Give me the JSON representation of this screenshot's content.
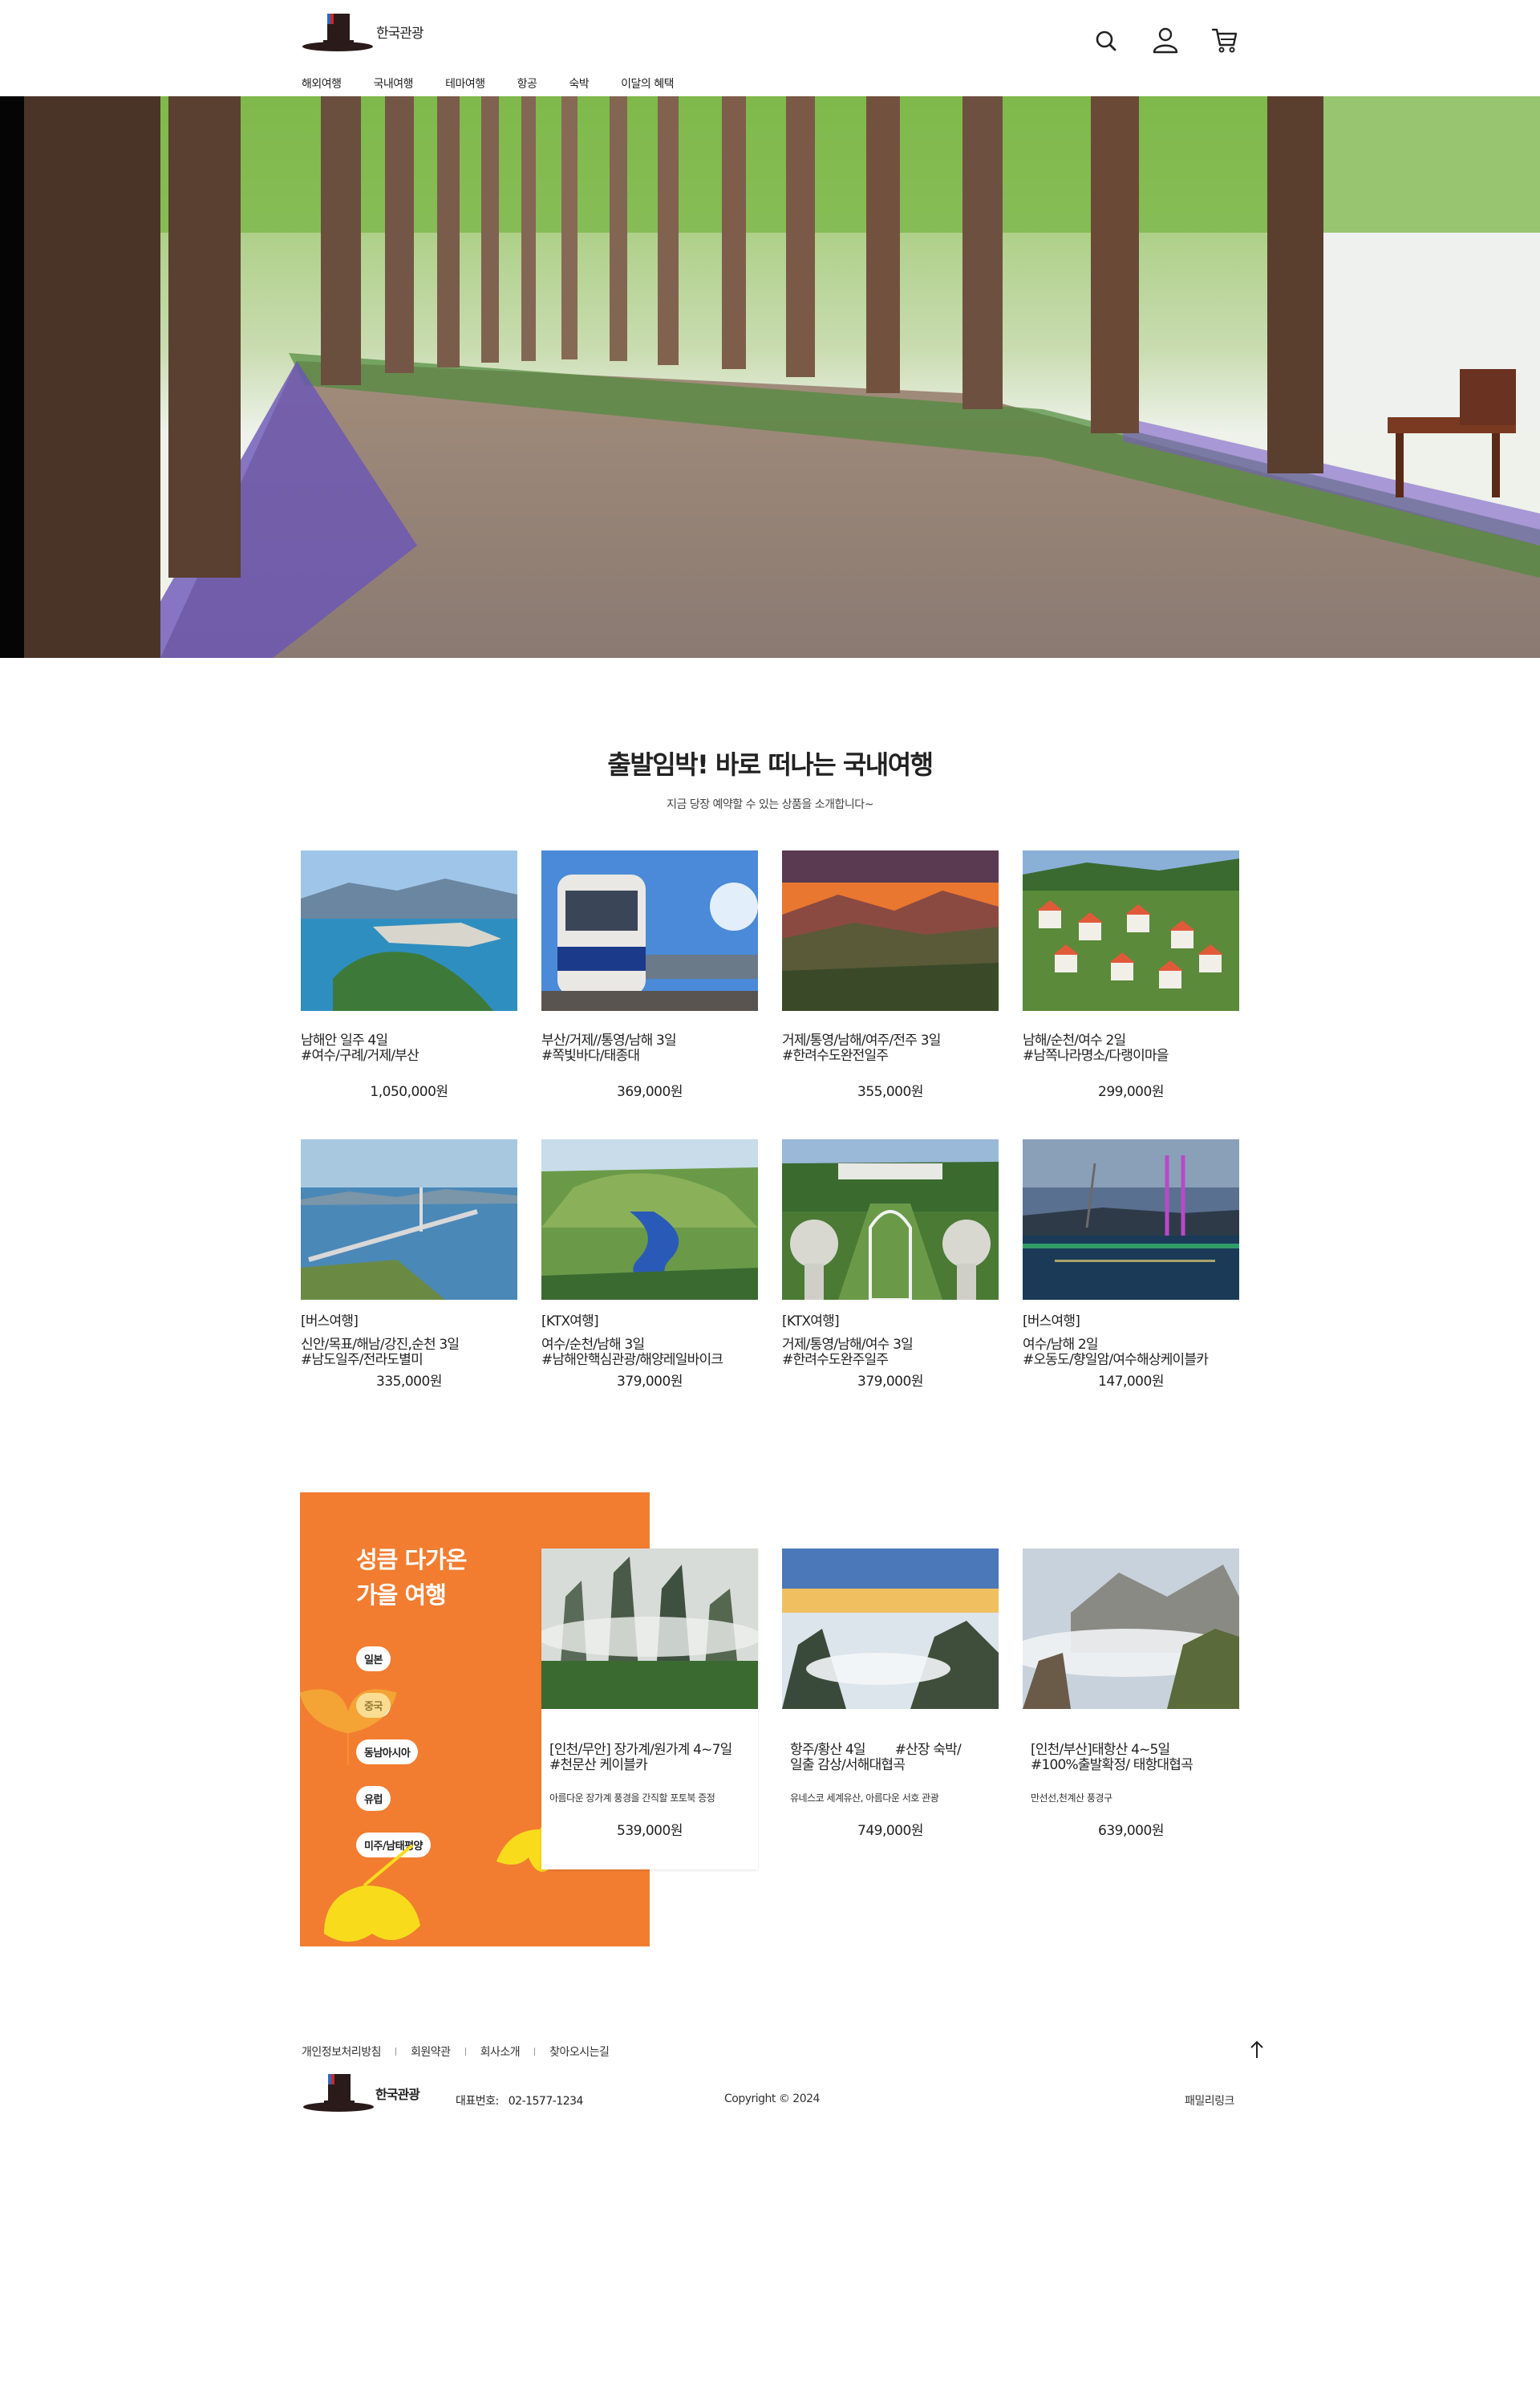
{
  "brand": {
    "name": "한국관광"
  },
  "header": {
    "nav": [
      "해외여행",
      "국내여행",
      "테마여행",
      "항공",
      "숙박",
      "이달의 혜택"
    ],
    "icons": [
      "search-icon",
      "user-icon",
      "cart-icon"
    ]
  },
  "hero": {
    "image": "metasequoia-road-photo"
  },
  "domestic": {
    "title": "출발임박! 바로 떠나는 국내여행",
    "subtitle": "지금 당장 예약할 수 있는 상품을 소개합니다~",
    "row1": [
      {
        "name": "남해안 일주 4일",
        "tags": "#여수/구례/거제/부산",
        "price": "1,050,000원",
        "image": "coastal-city"
      },
      {
        "name": "부산/거제//통영/남해 3일",
        "tags": "#쪽빛바다/태종대",
        "price": "369,000원",
        "image": "sky-capsule-train"
      },
      {
        "name": "거제/통영/남해/여주/전주 3일",
        "tags": "#한려수도완전일주",
        "price": "355,000원",
        "image": "sunset-mountains"
      },
      {
        "name": "남해/순천/여수 2일",
        "tags": "#남쪽나라명소/다랭이마을",
        "price": "299,000원",
        "image": "german-village"
      }
    ],
    "row2": [
      {
        "cat": "[버스여행]",
        "name": "신안/목표/해남/강진,순천 3일",
        "tags": "#남도일주/전라도별미",
        "price": "335,000원",
        "image": "sea-bridge"
      },
      {
        "cat": "[KTX여행]",
        "name": "여수/순천/남해 3일",
        "tags": "#남해안핵심관광/해양레일바이크",
        "price": "379,000원",
        "image": "suncheon-garden"
      },
      {
        "cat": "[KTX여행]",
        "name": "거제/통영/남해/여수 3일",
        "tags": "#한려수도완주일주",
        "price": "379,000원",
        "image": "windy-hill-garden"
      },
      {
        "cat": "[버스여행]",
        "name": "여수/남해 2일",
        "tags": "#오동도/향일암/여수해상케이블카",
        "price": "147,000원",
        "image": "yeosu-night"
      }
    ]
  },
  "autumn": {
    "title": "성큼 다가온\n가을 여행",
    "tags": [
      "일본",
      "중국",
      "동남아시아",
      "유럽",
      "미주/남태평양"
    ],
    "cards": [
      {
        "name": "[인천/무안] 장가계/원가계 4~7일\n#천문산 케이블카",
        "desc": "아름다운 장가계 풍경을 간직할 포토북 증정",
        "price": "539,000원",
        "image": "zhangjiajie-peaks"
      },
      {
        "name": "항주/황산 4일        #산장 숙박/\n일출 감상/서해대협곡",
        "desc": "유네스코 세계유산, 아름다운 서호 관광",
        "price": "749,000원",
        "image": "huangshan-sunrise"
      },
      {
        "name": "[인천/부산]태항산 4~5일\n#100%출발확정/ 태항대협곡",
        "desc": "만선선,천계산 풍경구",
        "price": "639,000원",
        "image": "taihang-cliffs"
      }
    ]
  },
  "footer": {
    "links": [
      "개인정보처리방침",
      "회원약관",
      "회사소개",
      "찾아오시는길"
    ],
    "tel_label": "대표번호:",
    "tel": "02-1577-1234",
    "copyright": "Copyright © 2024",
    "family": "패밀리링크"
  }
}
